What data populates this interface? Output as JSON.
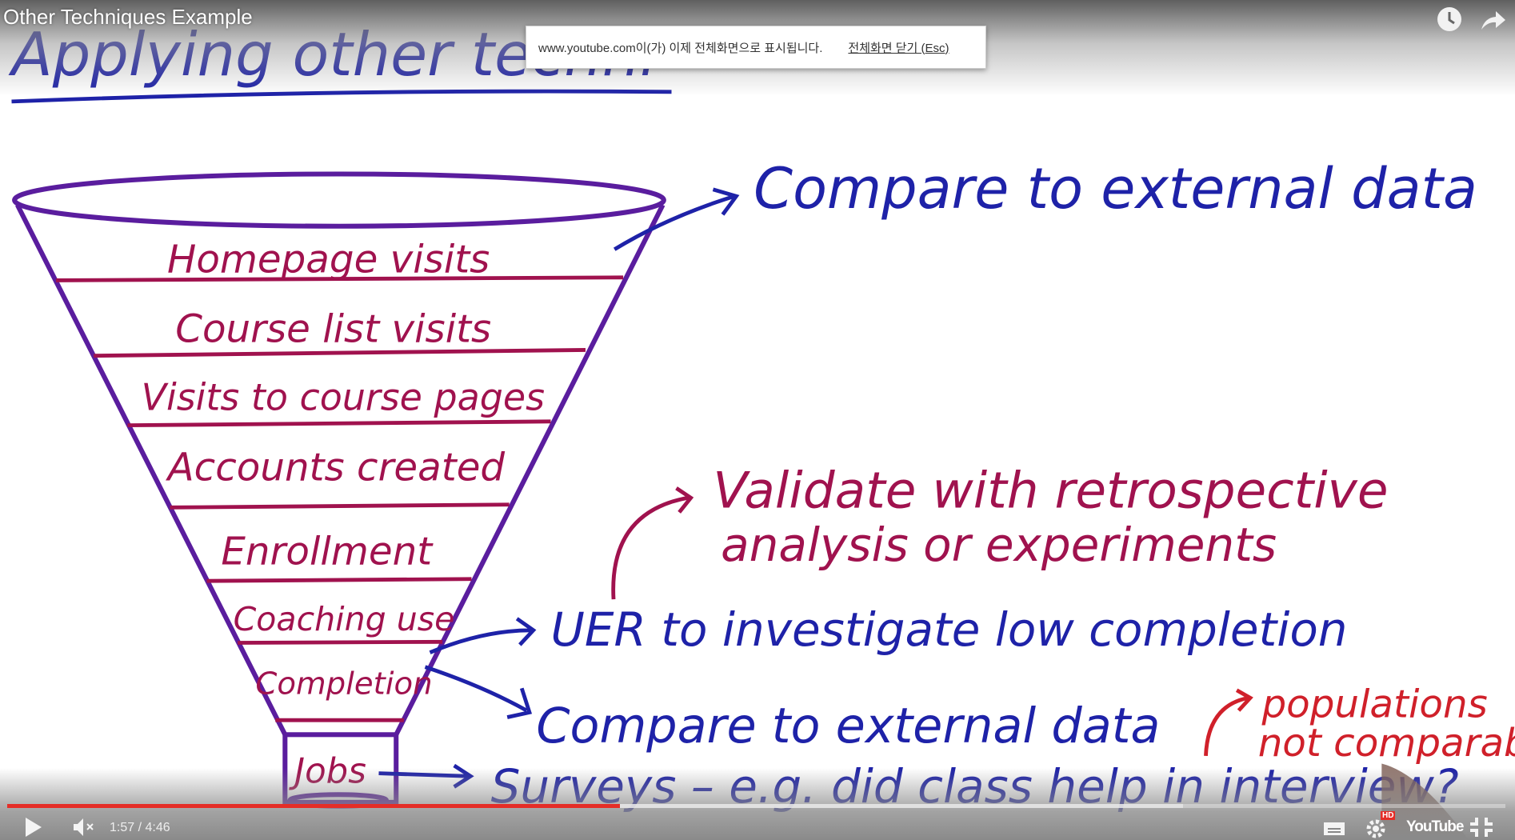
{
  "video": {
    "title": "Other Techniques Example",
    "current_time": "1:57",
    "duration": "4:46",
    "time_separator": " / ",
    "played_fraction": 0.409,
    "buffered_fraction": 0.785
  },
  "fullscreen_banner": {
    "message": "www.youtube.com이(가) 이제 전체화면으로 표시됩니다.",
    "exit_label": "전체화면 닫기 (Esc)"
  },
  "top_icons": [
    "watch-later-icon",
    "share-icon"
  ],
  "controls": [
    "play-icon",
    "mute-icon",
    "captions-icon",
    "settings-icon",
    "hd-badge",
    "youtube-logo",
    "exit-fullscreen-icon"
  ],
  "hd_badge": "HD",
  "youtube_logo": "YouTube",
  "board": {
    "heading": "Applying other techni",
    "funnel_stages": [
      "Homepage visits",
      "Course list visits",
      "Visits to course pages",
      "Accounts created",
      "Enrollment",
      "Coaching use",
      "Completion",
      "Jobs"
    ],
    "annotations": {
      "top": "Compare to external data",
      "validate_line1": "Validate with retrospective",
      "validate_line2": "analysis or experiments",
      "uer": "UER to investigate low completion",
      "compare_completion": "Compare to external data",
      "surveys": "Surveys – e.g. did class help in interview?",
      "populations_line1": "populations",
      "populations_line2": "not comparable"
    },
    "colors": {
      "funnel": "#5a1d9e",
      "bands": "#a0124e",
      "stage_text": "#a0124e",
      "annotation": "#1e22a8",
      "note": "#d0202a"
    }
  }
}
